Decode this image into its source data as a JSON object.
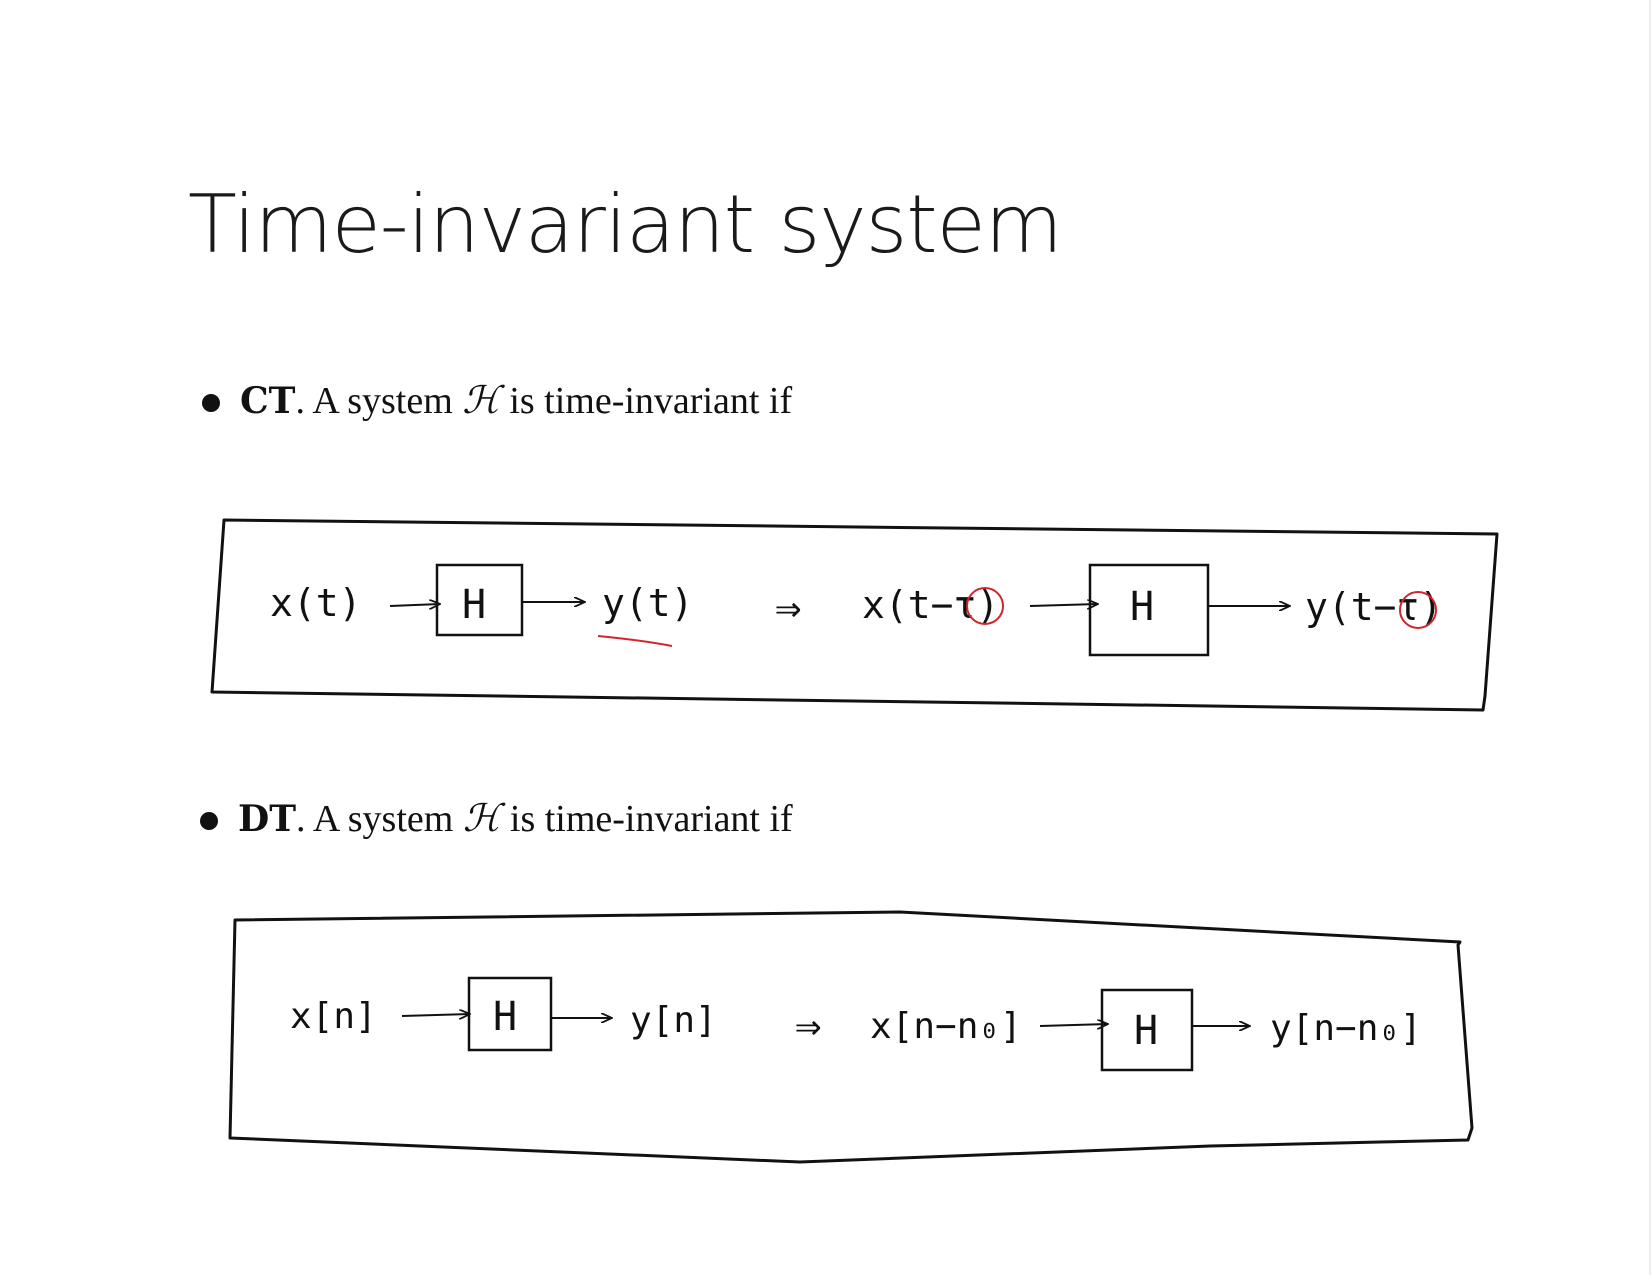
{
  "title": "Time-invariant system",
  "bullets": [
    {
      "bold": "CT",
      "rest_a": ". A system ",
      "symbol": "ℋ",
      "rest_b": " is time-invariant if"
    },
    {
      "bold": "DT",
      "rest_a": ". A system ",
      "symbol": "ℋ",
      "rest_b": " is time-invariant if"
    }
  ],
  "ct_diagram": {
    "input": "x(t)",
    "block": "H",
    "output": "y(t)",
    "implies": "⇒",
    "shifted_input": "x(t−τ)",
    "block2": "H",
    "shifted_output": "y(t−τ)"
  },
  "dt_diagram": {
    "input": "x[n]",
    "block": "H",
    "output": "y[n]",
    "implies": "⇒",
    "shifted_input": "x[n−n₀]",
    "block2": "H",
    "shifted_output": "y[n−n₀]"
  },
  "colors": {
    "ink": "#111111",
    "annotation_red": "#d0242e"
  }
}
